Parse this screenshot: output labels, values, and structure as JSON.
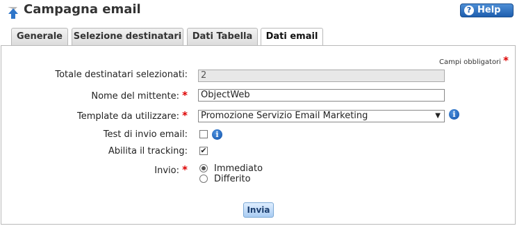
{
  "header": {
    "title": "Campagna email",
    "help_label": "Help",
    "title_icon": "arrow-up-icon",
    "help_icon": "question-icon"
  },
  "tabs": [
    {
      "label": "Generale"
    },
    {
      "label": "Selezione destinatari"
    },
    {
      "label": "Dati Tabella"
    },
    {
      "label": "Dati email"
    }
  ],
  "form": {
    "required_note": "Campi obbligatori",
    "total_label": "Totale destinatari selezionati:",
    "total_value": "2",
    "sender_label": "Nome del mittente:",
    "sender_value": "ObjectWeb",
    "template_label": "Template da utilizzare:",
    "template_value": "Promozione Servizio Email Marketing",
    "test_label": "Test di invio email:",
    "tracking_label": "Abilita il tracking:",
    "send_label": "Invio:",
    "send_options": [
      "Immediato",
      "Differito"
    ],
    "submit_label": "Invia"
  },
  "colors": {
    "accent": "#1e5eae",
    "required": "#dd0000"
  }
}
